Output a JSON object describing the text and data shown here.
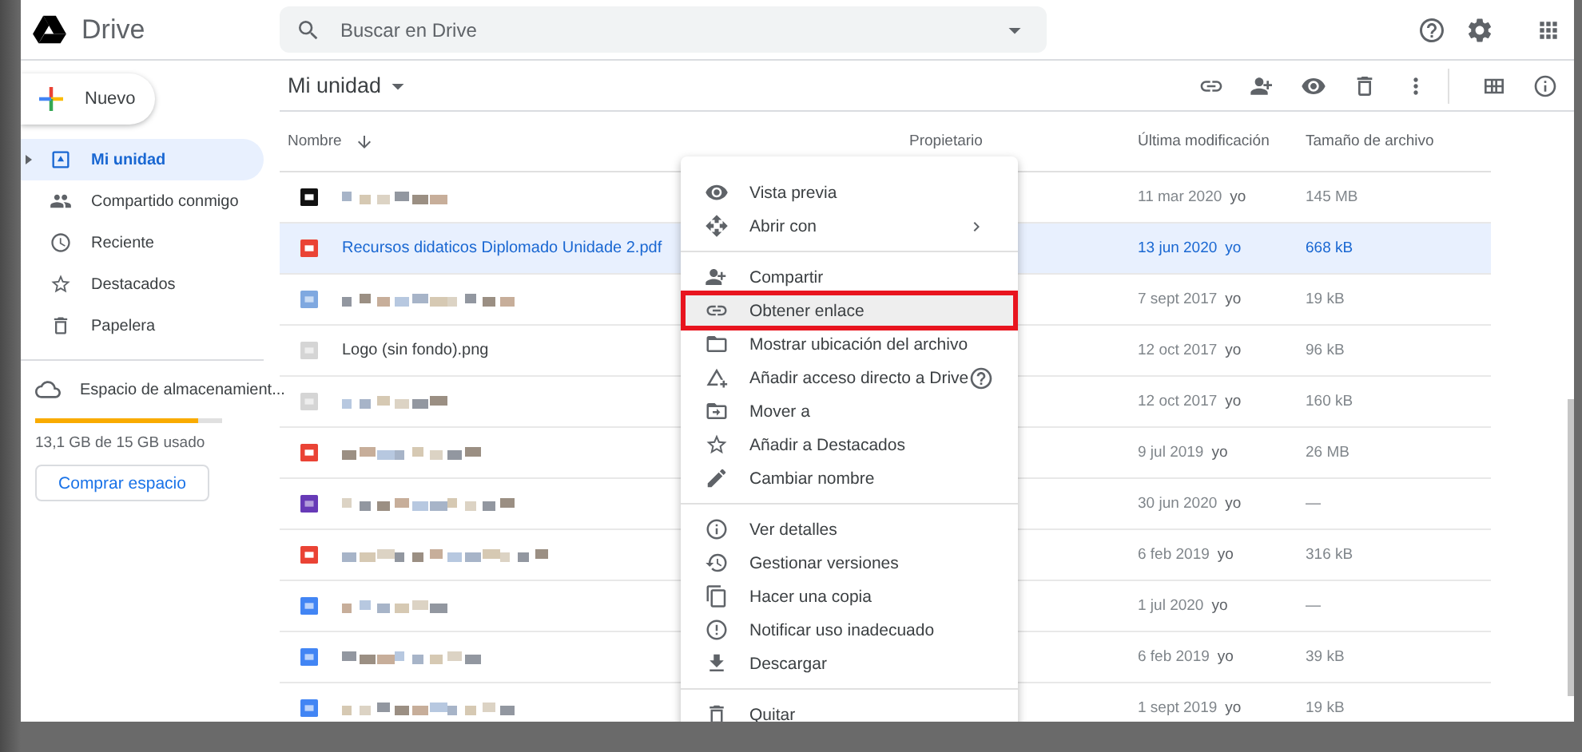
{
  "header": {
    "app_name": "Drive",
    "search": {
      "placeholder": "Buscar en Drive"
    }
  },
  "sidebar": {
    "new_button": "Nuevo",
    "items": [
      {
        "label": "Mi unidad",
        "selected": true,
        "expandable": true
      },
      {
        "label": "Compartido conmigo",
        "selected": false,
        "expandable": false
      },
      {
        "label": "Reciente",
        "selected": false,
        "expandable": false
      },
      {
        "label": "Destacados",
        "selected": false,
        "expandable": false
      },
      {
        "label": "Papelera",
        "selected": false,
        "expandable": false
      }
    ],
    "storage": {
      "label": "Espacio de almacenamient...",
      "level": 0.87,
      "usage": "13,1 GB de 15 GB usado",
      "button": "Comprar espacio"
    }
  },
  "main": {
    "title": "Mi unidad",
    "columns": [
      "Nombre",
      "Propietario",
      "Última modificación",
      "Tamaño de archivo"
    ],
    "rows": [
      {
        "kind": "darkimage",
        "modified": "11 mar 2020",
        "by": "yo",
        "size": "145 MB",
        "selected": false
      },
      {
        "kind": "pdf",
        "name": "Recursos didaticos Diplomado Unidade 2.pdf",
        "modified": "13 jun 2020",
        "by": "yo",
        "size": "668 kB",
        "selected": true
      },
      {
        "kind": "blueimage",
        "modified": "7 sept 2017",
        "by": "yo",
        "size": "19 kB",
        "selected": false
      },
      {
        "kind": "grayimage",
        "name": "Logo (sin fondo).png",
        "modified": "12 oct 2017",
        "by": "yo",
        "size": "96 kB",
        "selected": false
      },
      {
        "kind": "grayimage",
        "modified": "12 oct 2017",
        "by": "yo",
        "size": "160 kB",
        "selected": false
      },
      {
        "kind": "pdf",
        "modified": "9 jul 2019",
        "by": "yo",
        "size": "26 MB",
        "selected": false
      },
      {
        "kind": "form",
        "modified": "30 jun 2020",
        "by": "yo",
        "size": "—",
        "selected": false
      },
      {
        "kind": "pdf",
        "modified": "6 feb 2019",
        "by": "yo",
        "size": "316 kB",
        "selected": false
      },
      {
        "kind": "doc",
        "modified": "1 jul 2020",
        "by": "yo",
        "size": "—",
        "selected": false
      },
      {
        "kind": "doc",
        "modified": "6 feb 2019",
        "by": "yo",
        "size": "39 kB",
        "selected": false
      },
      {
        "kind": "doc",
        "modified": "1 sept 2019",
        "by": "yo",
        "size": "19 kB",
        "selected": false
      }
    ]
  },
  "context_menu": {
    "groups": [
      [
        {
          "label": "Vista previa",
          "submenu": false,
          "help": false,
          "hovered": false,
          "outlined": false
        },
        {
          "label": "Abrir con",
          "submenu": true,
          "help": false,
          "hovered": false,
          "outlined": false
        }
      ],
      [
        {
          "label": "Compartir",
          "submenu": false,
          "help": false,
          "hovered": false,
          "outlined": false
        },
        {
          "label": "Obtener enlace",
          "submenu": false,
          "help": false,
          "hovered": true,
          "outlined": true
        },
        {
          "label": "Mostrar ubicación del archivo",
          "submenu": false,
          "help": false,
          "hovered": false,
          "outlined": false
        },
        {
          "label": "Añadir acceso directo a Drive",
          "submenu": false,
          "help": true,
          "hovered": false,
          "outlined": false
        },
        {
          "label": "Mover a",
          "submenu": false,
          "help": false,
          "hovered": false,
          "outlined": false
        },
        {
          "label": "Añadir a Destacados",
          "submenu": false,
          "help": false,
          "hovered": false,
          "outlined": false
        },
        {
          "label": "Cambiar nombre",
          "submenu": false,
          "help": false,
          "hovered": false,
          "outlined": false
        }
      ],
      [
        {
          "label": "Ver detalles",
          "submenu": false,
          "help": false,
          "hovered": false,
          "outlined": false
        },
        {
          "label": "Gestionar versiones",
          "submenu": false,
          "help": false,
          "hovered": false,
          "outlined": false
        },
        {
          "label": "Hacer una copia",
          "submenu": false,
          "help": false,
          "hovered": false,
          "outlined": false
        },
        {
          "label": "Notificar uso inadecuado",
          "submenu": false,
          "help": false,
          "hovered": false,
          "outlined": false
        },
        {
          "label": "Descargar",
          "submenu": false,
          "help": false,
          "hovered": false,
          "outlined": false
        }
      ],
      [
        {
          "label": "Quitar",
          "submenu": false,
          "help": false,
          "hovered": false,
          "outlined": false
        }
      ]
    ]
  }
}
